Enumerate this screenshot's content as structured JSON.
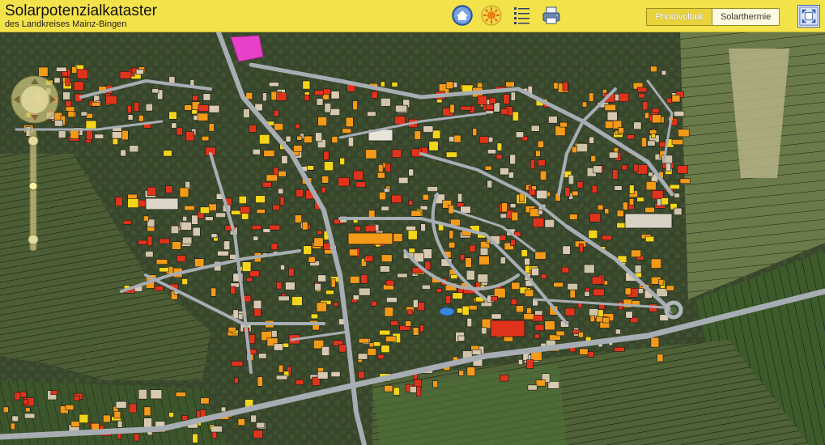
{
  "header": {
    "title": "Solarpotenzialkataster",
    "subtitle": "des Landkreises Mainz-Bingen"
  },
  "toolbar": {
    "icons": [
      "home-icon",
      "sun-icon",
      "list-icon",
      "print-icon"
    ]
  },
  "tabs": [
    {
      "label": "Photovoltaik",
      "active": true
    },
    {
      "label": "Solarthermie",
      "active": false
    }
  ],
  "colors": {
    "header_bg": "#f3e24a",
    "roof_red": "#e0331c",
    "roof_orange": "#f39a18",
    "roof_yellow": "#f3d51a",
    "selected_area": "#e840c8",
    "road": "#a8aeb5"
  }
}
